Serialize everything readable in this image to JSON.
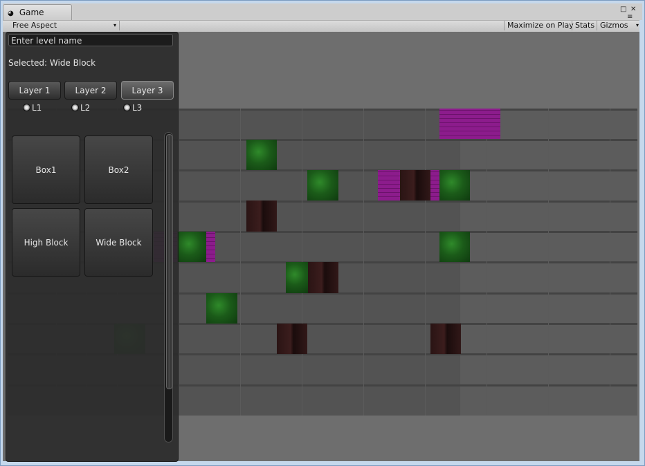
{
  "window": {
    "tab_label": "Game",
    "tab_icon": "pacman-icon",
    "close_glyph": "✕",
    "menu_glyph": "≡"
  },
  "toolbar": {
    "aspect_label": "Free Aspect",
    "aspect_arrow": "▾",
    "maximize_label": "Maximize on Play",
    "stats_label": "Stats",
    "gizmos_label": "Gizmos",
    "gizmos_arrow": "▾"
  },
  "editor": {
    "level_name_input": {
      "value": "Enter level name"
    },
    "selected_text": "Selected: Wide Block",
    "layers": [
      {
        "label": "Layer 1",
        "radio": "L1",
        "active": false
      },
      {
        "label": "Layer 2",
        "radio": "L2",
        "active": false
      },
      {
        "label": "Layer 3",
        "radio": "L3",
        "active": true
      }
    ],
    "blocks": [
      {
        "label": "Box1"
      },
      {
        "label": "Box2"
      },
      {
        "label": "High Block"
      },
      {
        "label": "Wide Block"
      }
    ]
  },
  "colors": {
    "panel_bg": "#2c2c2c",
    "level_bg": "#535353",
    "green_tile": "#1b5b19",
    "dark_tile": "#2a1414",
    "purple_tile": "#8c1c8c"
  }
}
